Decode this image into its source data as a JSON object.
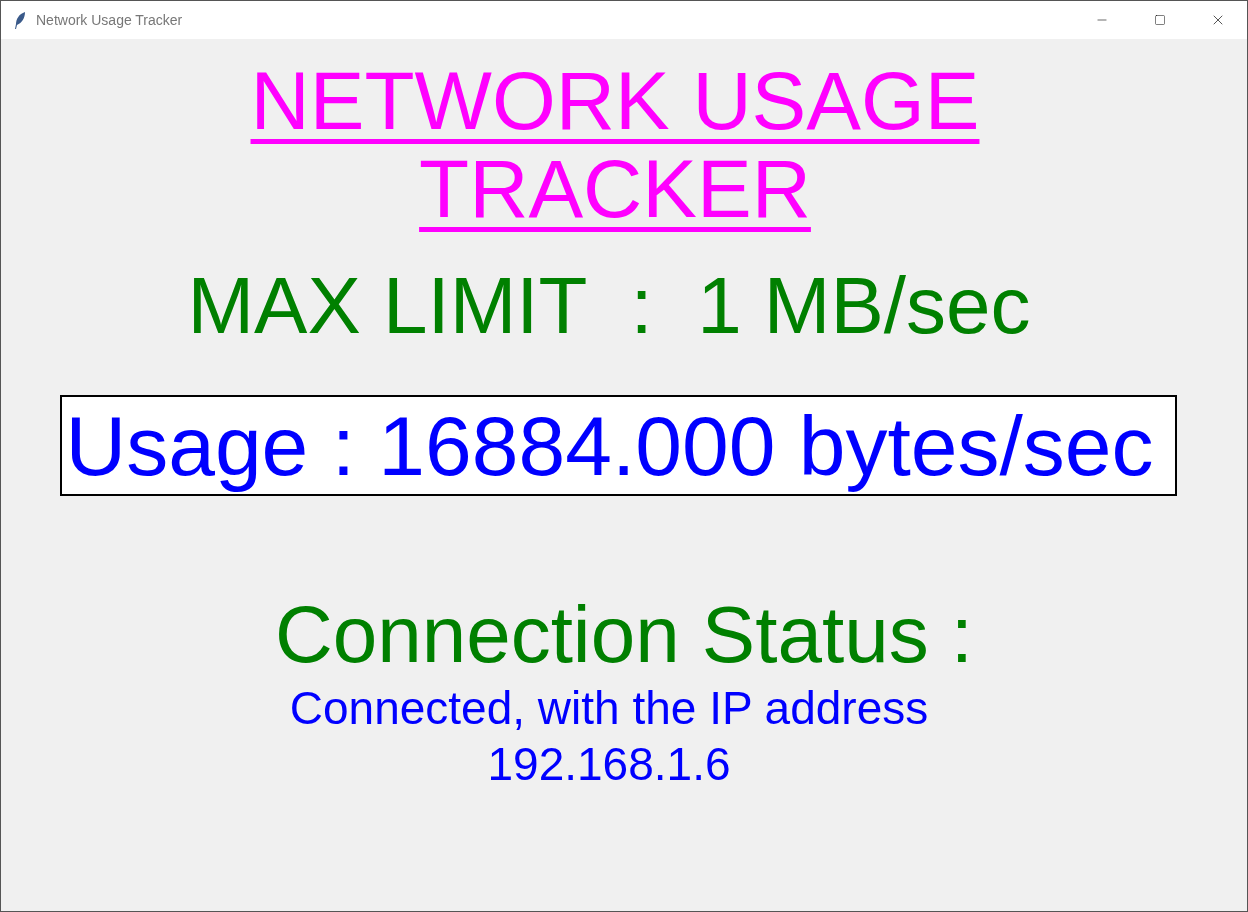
{
  "window": {
    "title": "Network Usage Tracker"
  },
  "heading": {
    "lines": [
      "NETWORK USAGE",
      "TRACKER"
    ]
  },
  "max_limit": "MAX LIMIT  :  1 MB/sec",
  "usage": "Usage : 16884.000 bytes/sec",
  "connection": {
    "label": "Connection Status :",
    "lines": [
      "Connected, with the IP address",
      "192.168.1.6"
    ]
  }
}
